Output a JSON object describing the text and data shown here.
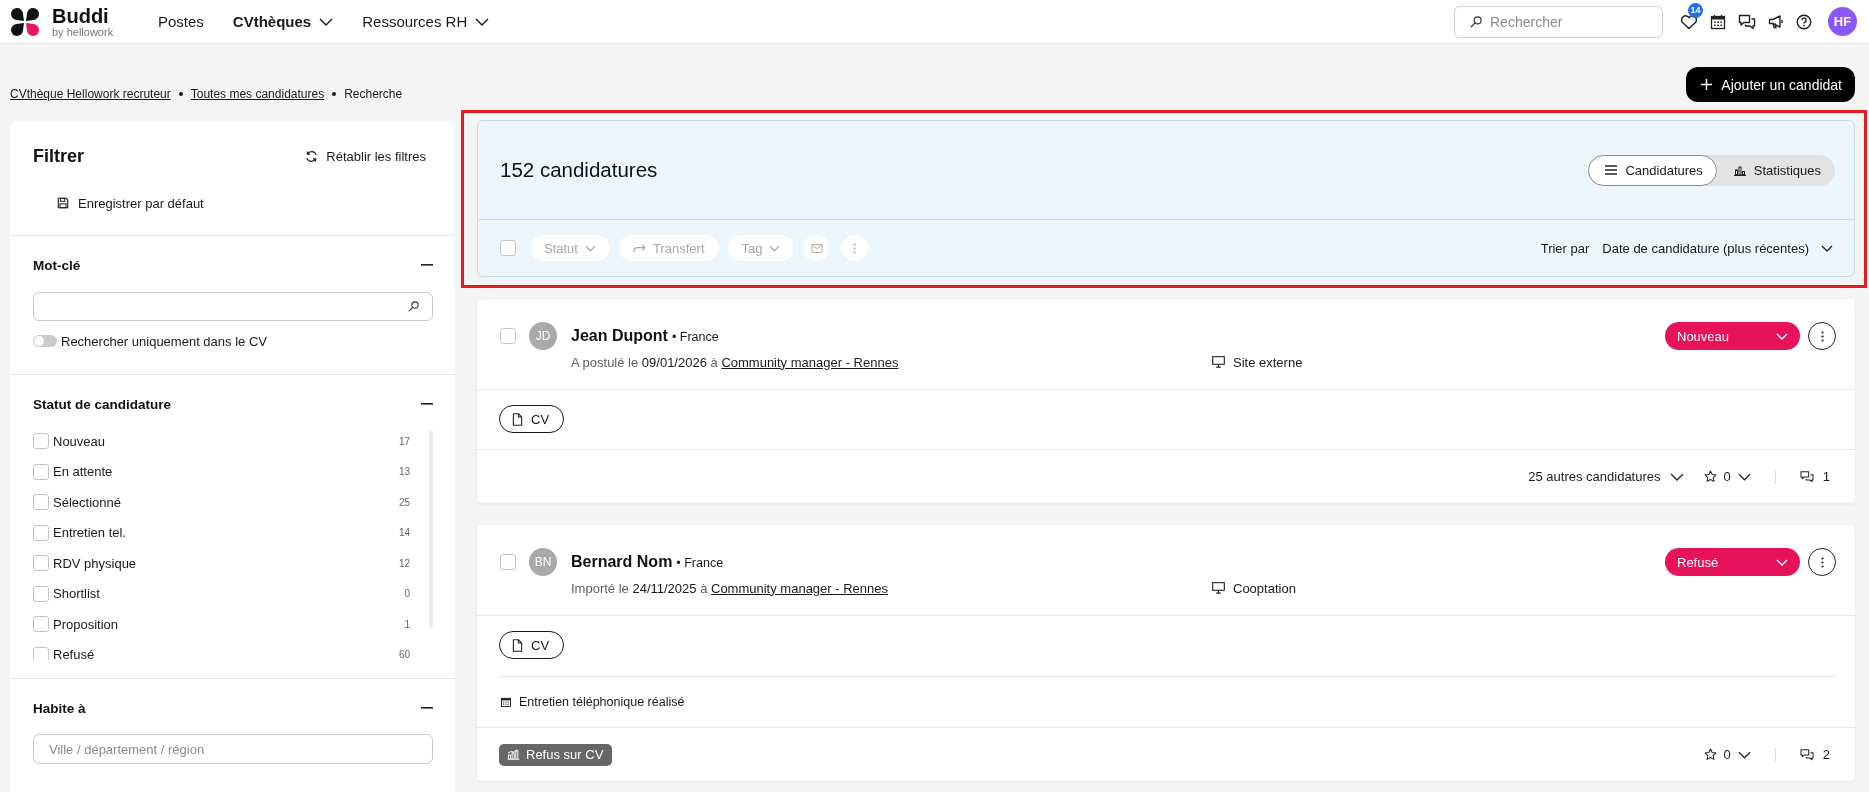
{
  "header": {
    "logo": {
      "name": "Buddi",
      "tagline": "by hellowork"
    },
    "nav": [
      {
        "label": "Postes",
        "selected": false,
        "dropdown": false
      },
      {
        "label": "CVthèques",
        "selected": true,
        "dropdown": true
      },
      {
        "label": "Ressources RH",
        "selected": false,
        "dropdown": true
      }
    ],
    "search": {
      "placeholder": "Rechercher"
    },
    "notifications_badge": "14",
    "avatar": "HF"
  },
  "breadcrumb": [
    {
      "label": "CVthèque Hellowork recruteur",
      "link": true
    },
    {
      "label": "Toutes mes candidatures",
      "link": true
    },
    {
      "label": "Recherche",
      "link": false
    }
  ],
  "add_button": "Ajouter un candidat",
  "filters": {
    "title": "Filtrer",
    "reset": "Rétablir les filtres",
    "save_default": "Enregistrer par défaut",
    "sections": [
      {
        "kind": "keyword",
        "title": "Mot-clé",
        "expanded": true,
        "toggle": {
          "label": "Rechercher uniquement dans le CV",
          "on": false
        }
      },
      {
        "kind": "checklist",
        "title": "Statut de candidature",
        "expanded": true,
        "options": [
          {
            "label": "Nouveau",
            "count": "17",
            "checked": false
          },
          {
            "label": "En attente",
            "count": "13",
            "checked": false
          },
          {
            "label": "Sélectionné",
            "count": "25",
            "checked": false
          },
          {
            "label": "Entretien tel.",
            "count": "14",
            "checked": false
          },
          {
            "label": "RDV physique",
            "count": "12",
            "checked": false
          },
          {
            "label": "Shortlist",
            "count": "0",
            "checked": false
          },
          {
            "label": "Proposition",
            "count": "1",
            "checked": false
          },
          {
            "label": "Refusé",
            "count": "60",
            "checked": false
          }
        ]
      },
      {
        "kind": "location",
        "title": "Habite à",
        "expanded": true,
        "placeholder": "Ville / département / région"
      }
    ]
  },
  "results": {
    "highlighted": true,
    "count": "152 candidatures",
    "views": [
      {
        "kind": "list",
        "label": "Candidatures",
        "selected": true
      },
      {
        "kind": "chart",
        "label": "Statistiques",
        "selected": false
      }
    ],
    "select_all": {
      "checked": false
    },
    "actions": [
      {
        "kind": "dropdown",
        "label": "Statut",
        "disabled": true
      },
      {
        "kind": "transfer",
        "label": "Transfert",
        "disabled": true
      },
      {
        "kind": "dropdown",
        "label": "Tag",
        "disabled": true
      },
      {
        "kind": "mail",
        "disabled": true
      },
      {
        "kind": "more",
        "disabled": true
      }
    ],
    "sort": {
      "label": "Trier par",
      "value": "Date de candidature (plus récentes)"
    },
    "candidates": [
      {
        "checked": false,
        "initials": "JD",
        "name": "Jean Dupont",
        "location": "• France",
        "action": "A postulé le",
        "date": "09/01/2026",
        "preposition": "à",
        "job": "Community manager - Rennes",
        "source": "Site externe",
        "status": "Nouveau",
        "documents": [
          "CV"
        ],
        "other_applications": "25 autres candidatures",
        "rating": "0",
        "comments": "1"
      },
      {
        "checked": false,
        "initials": "BN",
        "name": "Bernard Nom",
        "location": "• France",
        "action": "Importé le",
        "date": "24/11/2025",
        "preposition": "à",
        "job": "Community manager - Rennes",
        "source": "Cooptation",
        "status": "Refusé",
        "documents": [
          "CV"
        ],
        "events": [
          "Entretien téléphonique réalisé"
        ],
        "tags": [
          "Refus sur CV"
        ],
        "rating": "0",
        "comments": "2"
      }
    ]
  }
}
